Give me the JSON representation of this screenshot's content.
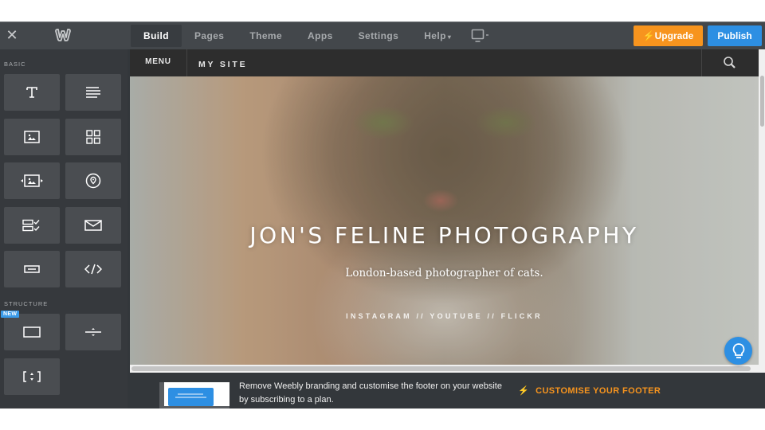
{
  "topbar": {
    "close_label": "✕",
    "tabs": [
      {
        "label": "Build",
        "active": true
      },
      {
        "label": "Pages",
        "active": false
      },
      {
        "label": "Theme",
        "active": false
      },
      {
        "label": "Apps",
        "active": false
      },
      {
        "label": "Settings",
        "active": false
      },
      {
        "label": "Help",
        "active": false,
        "dropdown": true
      }
    ],
    "dropdown_caret": "▾",
    "upgrade_label": "Upgrade",
    "upgrade_icon": "⚡",
    "publish_label": "Publish",
    "colors": {
      "upgrade": "#f7941e",
      "publish": "#2d8fe3"
    }
  },
  "sidebar": {
    "basic_label": "BASIC",
    "structure_label": "STRUCTURE",
    "new_badge": "NEW",
    "basic_elements": [
      {
        "name": "title",
        "icon": "text-icon"
      },
      {
        "name": "text",
        "icon": "paragraph-icon"
      },
      {
        "name": "image",
        "icon": "image-icon"
      },
      {
        "name": "gallery",
        "icon": "gallery-icon"
      },
      {
        "name": "slideshow",
        "icon": "slideshow-icon"
      },
      {
        "name": "map",
        "icon": "map-pin-icon"
      },
      {
        "name": "contact-form",
        "icon": "form-icon"
      },
      {
        "name": "newsletter",
        "icon": "envelope-icon"
      },
      {
        "name": "button",
        "icon": "button-icon"
      },
      {
        "name": "embed-code",
        "icon": "code-icon"
      }
    ],
    "structure_elements": [
      {
        "name": "section",
        "icon": "section-icon",
        "new": true
      },
      {
        "name": "divider",
        "icon": "divider-icon"
      },
      {
        "name": "spacer",
        "icon": "spacer-icon"
      }
    ]
  },
  "site": {
    "menu_label": "MENU",
    "site_title": "MY SITE",
    "hero_title": "JON'S FELINE PHOTOGRAPHY",
    "hero_subtitle": "London-based photographer of cats.",
    "social_links": "INSTAGRAM  //  YOUTUBE  //  FLICKR"
  },
  "footer_banner": {
    "message": "Remove Weebly branding and customise the footer on your website by subscribing to a plan.",
    "cta_label": "CUSTOMISE YOUR FOOTER",
    "cta_icon": "⚡"
  }
}
